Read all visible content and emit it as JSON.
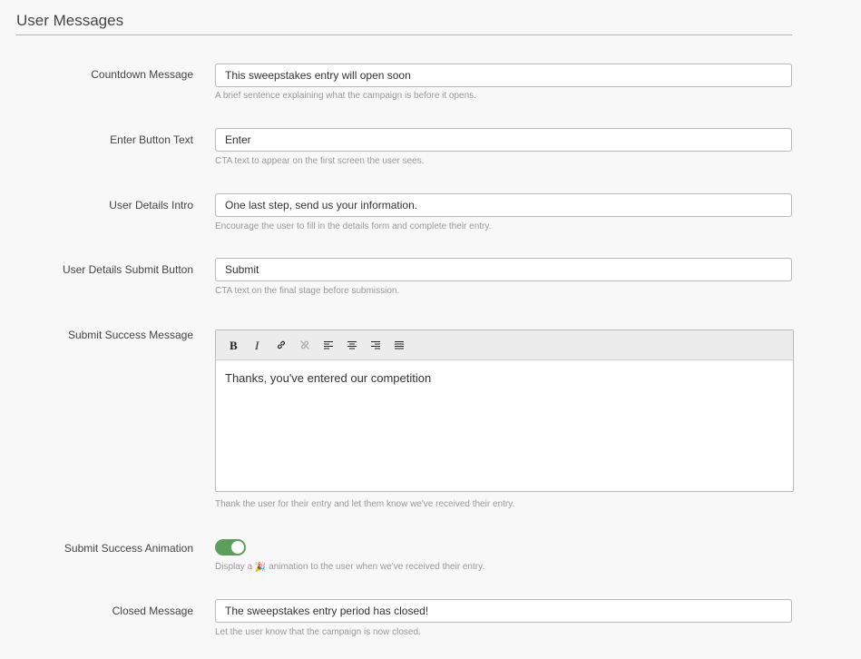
{
  "section": {
    "title": "User Messages"
  },
  "fields": {
    "countdown": {
      "label": "Countdown Message",
      "value": "This sweepstakes entry will open soon",
      "help": "A brief sentence explaining what the campaign is before it opens."
    },
    "enter_button": {
      "label": "Enter Button Text",
      "value": "Enter",
      "help": "CTA text to appear on the first screen the user sees."
    },
    "details_intro": {
      "label": "User Details Intro",
      "value": "One last step, send us your information.",
      "help": "Encourage the user to fill in the details form and complete their entry."
    },
    "details_submit": {
      "label": "User Details Submit Button",
      "value": "Submit",
      "help": "CTA text on the final stage before submission."
    },
    "success_message": {
      "label": "Submit Success Message",
      "value": "Thanks, you've entered our competition",
      "help": "Thank the user for their entry and let them know we've received their entry.",
      "toolbar": [
        "bold-icon",
        "italic-icon",
        "link-icon",
        "unlink-icon",
        "align-left-icon",
        "align-center-icon",
        "align-right-icon",
        "align-justify-icon"
      ]
    },
    "success_animation": {
      "label": "Submit Success Animation",
      "enabled": true,
      "toggle_color": "#5c9e5c",
      "help_before": "Display a",
      "help_icon": "party-popper-icon",
      "help_after": "animation to the user when we've received their entry."
    },
    "closed_message": {
      "label": "Closed Message",
      "value": "The sweepstakes entry period has closed!",
      "help": "Let the user know that the campaign is now closed."
    }
  }
}
